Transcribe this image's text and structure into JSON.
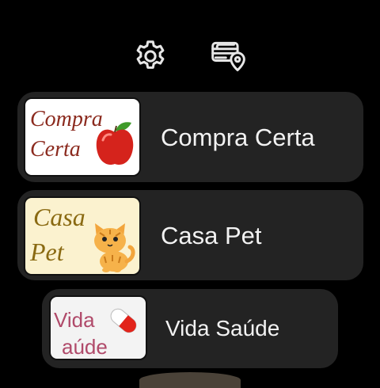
{
  "toolbar": {
    "settings_icon": "gear-icon",
    "wallet_icon": "card-location-icon"
  },
  "stores": [
    {
      "label": "Compra Certa",
      "thumb_line1": "Compra",
      "thumb_line2": "Certa",
      "thumb_bg": "#ffffff",
      "text_color": "#8b2a1e",
      "icon": "apple-icon"
    },
    {
      "label": "Casa Pet",
      "thumb_line1": "Casa",
      "thumb_line2": "Pet",
      "thumb_bg": "#fbf2cf",
      "text_color": "#8a6a12",
      "icon": "cat-icon"
    },
    {
      "label": "Vida Saúde",
      "thumb_line1": "Vida",
      "thumb_line2": "aúde",
      "thumb_bg": "#f3f3f3",
      "text_color": "#b04a6a",
      "icon": "pill-icon"
    }
  ],
  "colors": {
    "background": "#000000",
    "card": "#232323",
    "text": "#f2f2f2",
    "icon": "#e6e6e6"
  }
}
